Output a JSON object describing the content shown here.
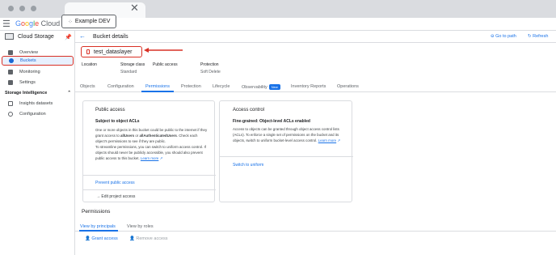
{
  "header": {
    "logo_google": "Google",
    "logo_cloud": "Cloud",
    "project": "Example DEV"
  },
  "nav": {
    "title": "Cloud Storage",
    "items": [
      {
        "label": "Overview"
      },
      {
        "label": "Buckets"
      },
      {
        "label": "Monitoring"
      },
      {
        "label": "Settings"
      }
    ],
    "section": "Storage Intelligence",
    "sub_items": [
      {
        "label": "Insights datasets"
      },
      {
        "label": "Configuration"
      }
    ]
  },
  "page": {
    "title": "Bucket details",
    "goto": "Go to path",
    "refresh": "Refresh",
    "bucket_name": "test_dataslayer"
  },
  "meta": {
    "location_label": "Location",
    "storage_class_label": "Storage class",
    "storage_class_value": "Standard",
    "public_access_label": "Public access",
    "protection_label": "Protection",
    "protection_value": "Soft Delete"
  },
  "tabs": [
    "Objects",
    "Configuration",
    "Permissions",
    "Protection",
    "Lifecycle",
    "Observability",
    "Inventory Reports",
    "Operations"
  ],
  "tab_badge": "New",
  "public_access_card": {
    "title": "Public access",
    "subtitle": "Subject to object ACLs",
    "body_1": "One or more objects in this bucket could be public to the internet if they grant access to ",
    "body_1b": "allUsers",
    "body_1c": " or ",
    "body_1d": "allAuthenticatedUsers",
    "body_1e": ". Check each object's permissions to see if they are public.",
    "body_2": "To streamline permissions, you can switch to uniform access control. If objects should never be publicly accessible, you should also prevent public access to this bucket. ",
    "learn_more": "Learn more",
    "action_1": "Prevent public access",
    "action_2": "Edit project access"
  },
  "access_control_card": {
    "title": "Access control",
    "subtitle": "Fine-grained: Object-level ACLs enabled",
    "body": "Access to objects can be granted through object access control lists (ACLs). To enforce a single set of permissions on the bucket and its objects, switch to uniform bucket-level access control. ",
    "learn_more": "Learn more",
    "action": "Switch to uniform"
  },
  "permissions": {
    "title": "Permissions",
    "tabs": [
      "View by principals",
      "View by roles"
    ],
    "grant": "Grant access",
    "remove": "Remove access"
  }
}
